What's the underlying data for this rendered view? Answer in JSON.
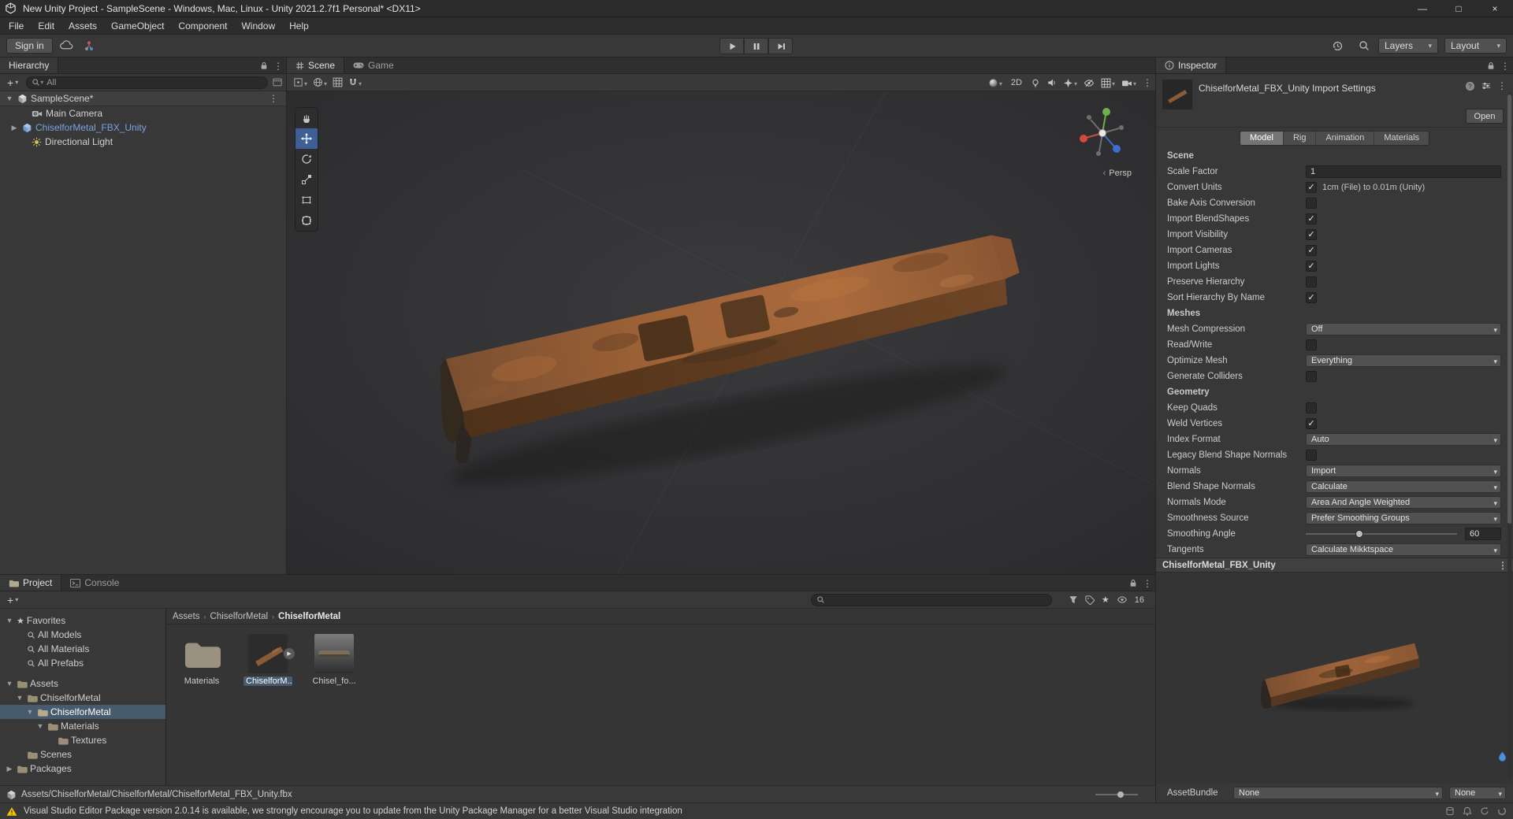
{
  "window": {
    "title": "New Unity Project - SampleScene - Windows, Mac, Linux - Unity 2021.2.7f1 Personal* <DX11>"
  },
  "icons": {
    "minimize": "—",
    "maximize": "□",
    "close": "×",
    "dropdown_arrow": "▾",
    "foldout_open": "▼",
    "foldout_closed": "▶",
    "menu_dots": "⋮",
    "favorites_star": "★",
    "checkmark": "✓",
    "chevron": "‹"
  },
  "menubar": {
    "items": [
      "File",
      "Edit",
      "Assets",
      "GameObject",
      "Component",
      "Window",
      "Help"
    ]
  },
  "toolbar": {
    "sign_in": "Sign in",
    "layers": "Layers",
    "layout": "Layout"
  },
  "hierarchy": {
    "tab": "Hierarchy",
    "search_text": "All",
    "scene_name": "SampleScene*",
    "items": [
      {
        "label": "Main Camera",
        "icon": "camera"
      },
      {
        "label": "ChiselforMetal_FBX_Unity",
        "icon": "prefab"
      },
      {
        "label": "Directional Light",
        "icon": "light"
      }
    ]
  },
  "scene": {
    "tabs": [
      {
        "label": "Scene",
        "active": true
      },
      {
        "label": "Game",
        "active": false
      }
    ],
    "btn_2d": "2D",
    "persp": "Persp"
  },
  "inspector": {
    "tab": "Inspector",
    "title": "ChiselforMetal_FBX_Unity Import Settings",
    "open": "Open",
    "tabs": [
      {
        "label": "Model",
        "active": true
      },
      {
        "label": "Rig",
        "active": false
      },
      {
        "label": "Animation",
        "active": false
      },
      {
        "label": "Materials",
        "active": false
      }
    ],
    "rows": [
      {
        "type": "header",
        "label": "Scene"
      },
      {
        "type": "text",
        "label": "Scale Factor",
        "value": "1"
      },
      {
        "type": "check",
        "label": "Convert Units",
        "checked": true,
        "note": "1cm (File) to 0.01m (Unity)"
      },
      {
        "type": "check",
        "label": "Bake Axis Conversion",
        "checked": false
      },
      {
        "type": "check",
        "label": "Import BlendShapes",
        "checked": true
      },
      {
        "type": "check",
        "label": "Import Visibility",
        "checked": true
      },
      {
        "type": "check",
        "label": "Import Cameras",
        "checked": true
      },
      {
        "type": "check",
        "label": "Import Lights",
        "checked": true
      },
      {
        "type": "check",
        "label": "Preserve Hierarchy",
        "checked": false
      },
      {
        "type": "check",
        "label": "Sort Hierarchy By Name",
        "checked": true
      },
      {
        "type": "header",
        "label": "Meshes"
      },
      {
        "type": "dropdown",
        "label": "Mesh Compression",
        "value": "Off"
      },
      {
        "type": "check",
        "label": "Read/Write",
        "checked": false
      },
      {
        "type": "dropdown",
        "label": "Optimize Mesh",
        "value": "Everything"
      },
      {
        "type": "check",
        "label": "Generate Colliders",
        "checked": false
      },
      {
        "type": "header",
        "label": "Geometry"
      },
      {
        "type": "check",
        "label": "Keep Quads",
        "checked": false
      },
      {
        "type": "check",
        "label": "Weld Vertices",
        "checked": true
      },
      {
        "type": "dropdown",
        "label": "Index Format",
        "value": "Auto"
      },
      {
        "type": "check",
        "label": "Legacy Blend Shape Normals",
        "checked": false
      },
      {
        "type": "dropdown",
        "label": "Normals",
        "value": "Import"
      },
      {
        "type": "dropdown",
        "label": "Blend Shape Normals",
        "value": "Calculate"
      },
      {
        "type": "dropdown",
        "label": "Normals Mode",
        "value": "Area And Angle Weighted"
      },
      {
        "type": "dropdown",
        "label": "Smoothness Source",
        "value": "Prefer Smoothing Groups"
      },
      {
        "type": "slider",
        "label": "Smoothing Angle",
        "value": "60"
      },
      {
        "type": "dropdown",
        "label": "Tangents",
        "value": "Calculate Mikktspace"
      }
    ],
    "preview_title": "ChiselforMetal_FBX_Unity",
    "assetbundle": {
      "label": "AssetBundle",
      "bundle": "None",
      "variant": "None"
    }
  },
  "project": {
    "tabs": [
      {
        "label": "Project",
        "active": true
      },
      {
        "label": "Console",
        "active": false
      }
    ],
    "hidden_count": "16",
    "tree": [
      {
        "label": "Favorites",
        "depth": 0,
        "icon": "star",
        "state": "open"
      },
      {
        "label": "All Models",
        "depth": 1,
        "icon": "search"
      },
      {
        "label": "All Materials",
        "depth": 1,
        "icon": "search"
      },
      {
        "label": "All Prefabs",
        "depth": 1,
        "icon": "search"
      },
      {
        "label": "Assets",
        "depth": 0,
        "icon": "folder",
        "state": "open"
      },
      {
        "label": "ChiselforMetal",
        "depth": 1,
        "icon": "folder",
        "state": "open"
      },
      {
        "label": "ChiselforMetal",
        "depth": 2,
        "icon": "folder",
        "state": "open",
        "selected": true
      },
      {
        "label": "Materials",
        "depth": 3,
        "icon": "folder",
        "state": "open"
      },
      {
        "label": "Textures",
        "depth": 4,
        "icon": "folder"
      },
      {
        "label": "Scenes",
        "depth": 1,
        "icon": "folder"
      },
      {
        "label": "Packages",
        "depth": 0,
        "icon": "folder",
        "state": "closed"
      }
    ],
    "breadcrumb": [
      "Assets",
      "ChiselforMetal",
      "ChiselforMetal"
    ],
    "grid": [
      {
        "label": "Materials",
        "kind": "folder"
      },
      {
        "label": "ChiselforM...",
        "kind": "model",
        "selected": true
      },
      {
        "label": "Chisel_fo...",
        "kind": "material"
      }
    ],
    "selected_path": "Assets/ChiselforMetal/ChiselforMetal/ChiselforMetal_FBX_Unity.fbx"
  },
  "statusbar": {
    "message": "Visual Studio Editor Package version 2.0.14 is available, we strongly encourage you to update from the Unity Package Manager for a better Visual Studio integration"
  },
  "colors": {
    "selection": "#475b6e",
    "prefab_text": "#7aa3e0",
    "warning": "#f2c200",
    "tool_active": "#3e5f96"
  }
}
